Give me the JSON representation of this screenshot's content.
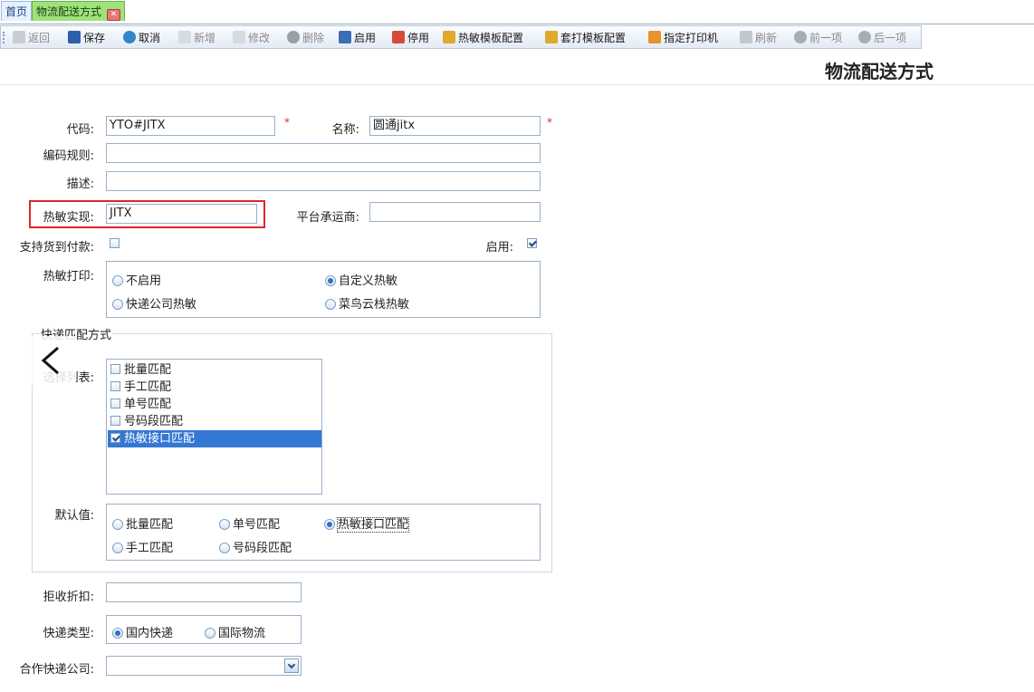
{
  "tabs": [
    {
      "label": "首页"
    },
    {
      "label": "物流配送方式",
      "close_icon": "close-icon"
    }
  ],
  "toolbar": {
    "items": [
      {
        "label": "返回",
        "icon": "back-icon",
        "enabled": false
      },
      {
        "label": "保存",
        "icon": "save-icon",
        "enabled": true
      },
      {
        "label": "取消",
        "icon": "undo-icon",
        "enabled": true
      },
      {
        "label": "新增",
        "icon": "new-document-icon",
        "enabled": false
      },
      {
        "label": "修改",
        "icon": "edit-document-icon",
        "enabled": false
      },
      {
        "label": "删除",
        "icon": "delete-icon",
        "enabled": false
      },
      {
        "label": "启用",
        "icon": "monitor-icon",
        "enabled": true
      },
      {
        "label": "停用",
        "icon": "disable-icon",
        "enabled": true
      },
      {
        "label": "热敏模板配置",
        "icon": "upload-template-icon",
        "enabled": true
      },
      {
        "label": "套打模板配置",
        "icon": "upload-template-icon",
        "enabled": true
      },
      {
        "label": "指定打印机",
        "icon": "printer-icon",
        "enabled": true
      },
      {
        "label": "刷新",
        "icon": "refresh-icon",
        "enabled": false
      },
      {
        "label": "前一项",
        "icon": "previous-icon",
        "enabled": false
      },
      {
        "label": "后一项",
        "icon": "next-icon",
        "enabled": false
      }
    ]
  },
  "page_title": "物流配送方式",
  "form": {
    "code_label": "代码:",
    "code_value": "YTO#JITX",
    "name_label": "名称:",
    "name_value": "圆通jitx",
    "required_mark": "*",
    "encoding_rule_label": "编码规则:",
    "encoding_rule_value": "",
    "description_label": "描述:",
    "description_value": "",
    "thermal_impl_label": "热敏实现:",
    "thermal_impl_value": "JITX",
    "platform_carrier_label": "平台承运商:",
    "platform_carrier_value": "",
    "cod_label": "支持货到付款:",
    "cod_checked": false,
    "enable_label": "启用:",
    "enable_checked": true,
    "thermal_print_label": "热敏打印:",
    "thermal_print_options": [
      {
        "label": "不启用",
        "checked": false
      },
      {
        "label": "自定义热敏",
        "checked": true
      },
      {
        "label": "快递公司热敏",
        "checked": false
      },
      {
        "label": "菜鸟云栈热敏",
        "checked": false
      }
    ],
    "match_group_legend": "快递匹配方式",
    "select_list_label": "选择列表:",
    "select_list_items": [
      {
        "label": "批量匹配",
        "checked": false,
        "selected": false
      },
      {
        "label": "手工匹配",
        "checked": false,
        "selected": false
      },
      {
        "label": "单号匹配",
        "checked": false,
        "selected": false
      },
      {
        "label": "号码段匹配",
        "checked": false,
        "selected": false
      },
      {
        "label": "热敏接口匹配",
        "checked": true,
        "selected": true
      }
    ],
    "default_value_label": "默认值:",
    "default_value_options": [
      {
        "label": "批量匹配",
        "checked": false
      },
      {
        "label": "单号匹配",
        "checked": false
      },
      {
        "label": "热敏接口匹配",
        "checked": true
      },
      {
        "label": "手工匹配",
        "checked": false
      },
      {
        "label": "号码段匹配",
        "checked": false
      }
    ],
    "reject_discount_label": "拒收折扣:",
    "reject_discount_value": "",
    "express_type_label": "快递类型:",
    "express_type_options": [
      {
        "label": "国内快递",
        "checked": true
      },
      {
        "label": "国际物流",
        "checked": false
      }
    ],
    "partner_company_label": "合作快递公司:",
    "partner_company_value": ""
  },
  "colors": {
    "highlight_border": "#e0262b",
    "selected_row": "#3478d3",
    "active_tab": "#9ee27a",
    "required": "#d12f2f"
  }
}
